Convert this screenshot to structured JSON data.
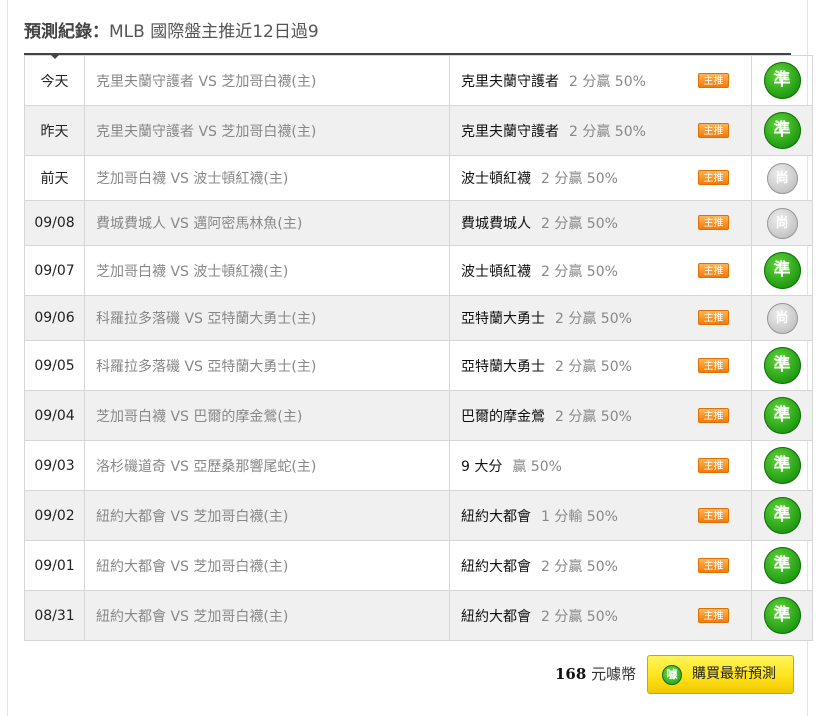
{
  "header": {
    "label": "預測紀錄：",
    "title": "MLB 國際盤主推近12日過9"
  },
  "rows": [
    {
      "date": "今天",
      "match": "克里夫蘭守護者 VS 芝加哥白襪(主)",
      "pick_team": "克里夫蘭守護者",
      "pick_odds": "2 分贏 50%",
      "badge": "主推",
      "result": "準"
    },
    {
      "date": "昨天",
      "match": "克里夫蘭守護者 VS 芝加哥白襪(主)",
      "pick_team": "克里夫蘭守護者",
      "pick_odds": "2 分贏 50%",
      "badge": "主推",
      "result": "準"
    },
    {
      "date": "前天",
      "match": "芝加哥白襪 VS 波士頓紅襪(主)",
      "pick_team": "波士頓紅襪",
      "pick_odds": "2 分贏 50%",
      "badge": "主推",
      "result": "尚"
    },
    {
      "date": "09/08",
      "match": "費城費城人 VS 邁阿密馬林魚(主)",
      "pick_team": "費城費城人",
      "pick_odds": "2 分贏 50%",
      "badge": "主推",
      "result": "尚"
    },
    {
      "date": "09/07",
      "match": "芝加哥白襪 VS 波士頓紅襪(主)",
      "pick_team": "波士頓紅襪",
      "pick_odds": "2 分贏 50%",
      "badge": "主推",
      "result": "準"
    },
    {
      "date": "09/06",
      "match": "科羅拉多落磯 VS 亞特蘭大勇士(主)",
      "pick_team": "亞特蘭大勇士",
      "pick_odds": "2 分贏 50%",
      "badge": "主推",
      "result": "尚"
    },
    {
      "date": "09/05",
      "match": "科羅拉多落磯 VS 亞特蘭大勇士(主)",
      "pick_team": "亞特蘭大勇士",
      "pick_odds": "2 分贏 50%",
      "badge": "主推",
      "result": "準"
    },
    {
      "date": "09/04",
      "match": "芝加哥白襪 VS 巴爾的摩金鶯(主)",
      "pick_team": "巴爾的摩金鶯",
      "pick_odds": "2 分贏 50%",
      "badge": "主推",
      "result": "準"
    },
    {
      "date": "09/03",
      "match": "洛杉磯道奇 VS 亞歷桑那響尾蛇(主)",
      "pick_team": "9 大分",
      "pick_odds": "贏 50%",
      "badge": "主推",
      "result": "準"
    },
    {
      "date": "09/02",
      "match": "紐約大都會 VS 芝加哥白襪(主)",
      "pick_team": "紐約大都會",
      "pick_odds": "1 分輸 50%",
      "badge": "主推",
      "result": "準"
    },
    {
      "date": "09/01",
      "match": "紐約大都會 VS 芝加哥白襪(主)",
      "pick_team": "紐約大都會",
      "pick_odds": "2 分贏 50%",
      "badge": "主推",
      "result": "準"
    },
    {
      "date": "08/31",
      "match": "紐約大都會 VS 芝加哥白襪(主)",
      "pick_team": "紐約大都會",
      "pick_odds": "2 分贏 50%",
      "badge": "主推",
      "result": "準"
    }
  ],
  "footer": {
    "price_amount": "168",
    "price_unit": "元噱幣",
    "buy_icon_text": "噱",
    "buy_label": "購買最新預測"
  },
  "colors": {
    "win": "#1f9a12",
    "tie": "#c4c4c4",
    "badge": "#f07b0a",
    "button": "#ffe21a"
  }
}
